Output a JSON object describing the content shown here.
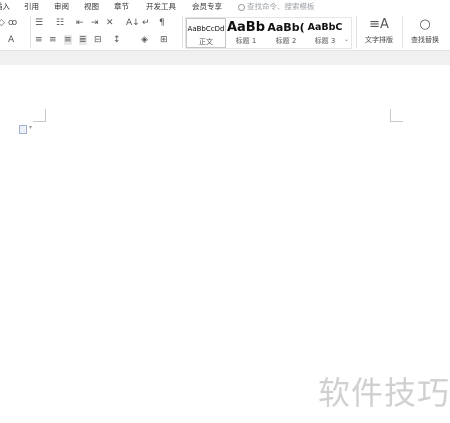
{
  "menu": {
    "items": [
      "插入",
      "引用",
      "审阅",
      "视图",
      "章节",
      "开发工具",
      "会员专享"
    ],
    "search_placeholder": "查找命令、搜索模板"
  },
  "styles": [
    {
      "sample": "AaBbCcDd",
      "name": "正文"
    },
    {
      "sample": "AaBb",
      "name": "标题 1"
    },
    {
      "sample": "AaBb(",
      "name": "标题 2"
    },
    {
      "sample": "AaBbC",
      "name": "标题 3"
    }
  ],
  "ribbon": {
    "text_layout_label": "文字排版",
    "find_replace_label": "查找替换"
  },
  "watermark": "软件技巧"
}
